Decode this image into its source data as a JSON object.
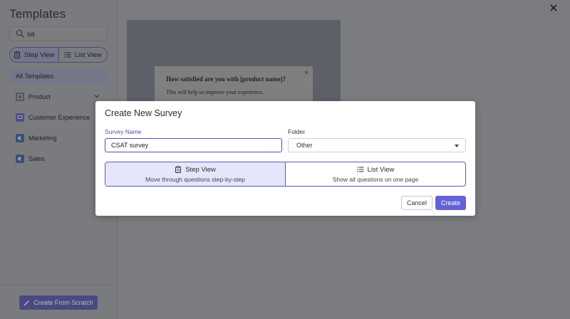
{
  "sidebar": {
    "title": "Templates",
    "search": {
      "value": "sa",
      "icon": "search-icon"
    },
    "view_toggle": [
      {
        "label": "Step View",
        "icon": "clipboard-icon",
        "active": true
      },
      {
        "label": "List View",
        "icon": "list-icon",
        "active": false
      }
    ],
    "all_templates": "All Templates",
    "categories": [
      {
        "label": "Product",
        "icon": "box-icon",
        "color": "#55565f"
      },
      {
        "label": "Customer Experience",
        "icon": "chat-icon",
        "color": "#4e4f82"
      },
      {
        "label": "Marketing",
        "icon": "megaphone-icon",
        "color": "#3e4f73"
      },
      {
        "label": "Sales",
        "icon": "megaphone-icon",
        "color": "#3e4f73"
      }
    ],
    "create_from_scratch": "Create From Scratch"
  },
  "preview": {
    "question": "How satisfied are you with [product name]?",
    "subtext": "This will help us improve your experience.",
    "close": "×"
  },
  "modal": {
    "title": "Create New Survey",
    "survey_name_label": "Survey Name",
    "survey_name_value": "CSAT survey",
    "folder_label": "Folder",
    "folder_value": "Other",
    "views": [
      {
        "label": "Step View",
        "description": "Move through questions step-by-step",
        "icon": "clipboard-icon",
        "selected": true
      },
      {
        "label": "List View",
        "description": "Show all questions on one page",
        "icon": "list-icon",
        "selected": false
      }
    ],
    "cancel_label": "Cancel",
    "create_label": "Create"
  },
  "colors": {
    "accent": "#6462d9",
    "accent_light": "#e6e6fb",
    "overlay": "#7b7c80"
  }
}
